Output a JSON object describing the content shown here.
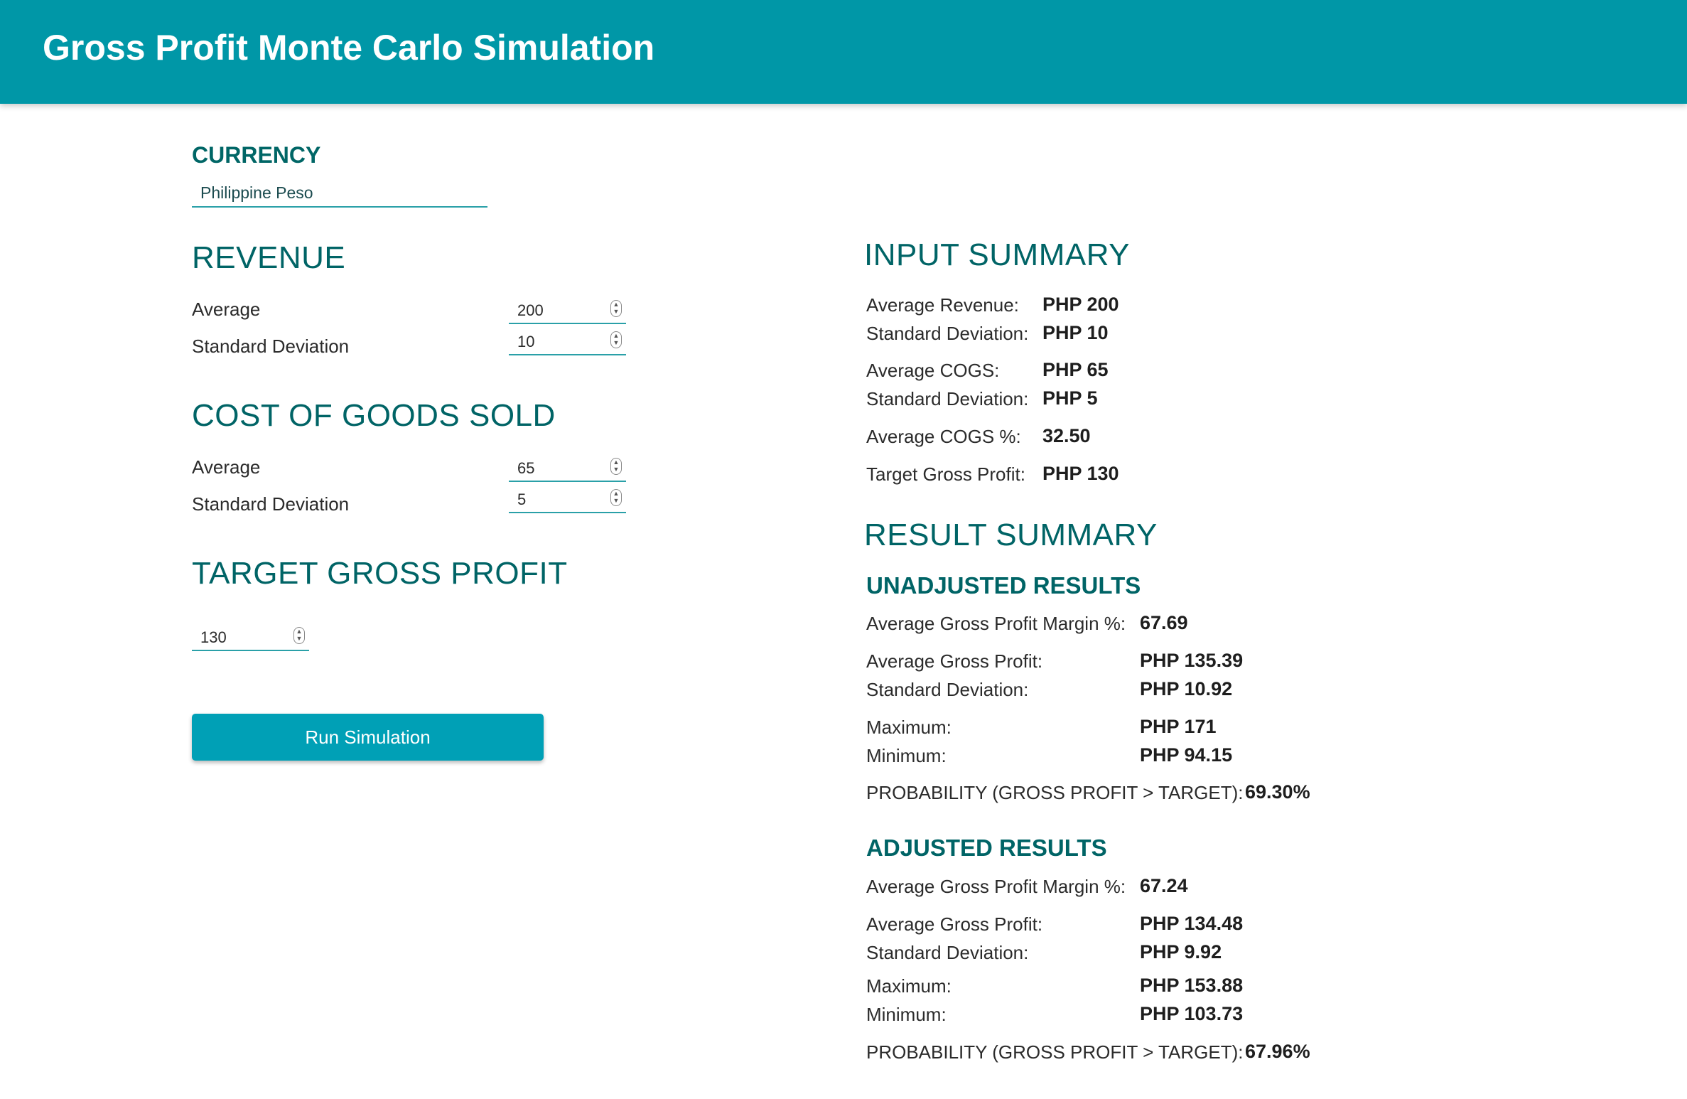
{
  "header": {
    "title": "Gross Profit Monte Carlo Simulation"
  },
  "currency": {
    "heading": "CURRENCY",
    "selected": "Philippine Peso"
  },
  "revenue": {
    "heading": "REVENUE",
    "average_label": "Average",
    "average_value": "200",
    "std_label": "Standard Deviation",
    "std_value": "10"
  },
  "cogs": {
    "heading": "COST OF GOODS SOLD",
    "average_label": "Average",
    "average_value": "65",
    "std_label": "Standard Deviation",
    "std_value": "5"
  },
  "target": {
    "heading": "TARGET GROSS PROFIT",
    "value": "130"
  },
  "run_button_label": "Run Simulation",
  "input_summary": {
    "heading": "INPUT SUMMARY",
    "rows": [
      {
        "label": "Average Revenue:",
        "value": "PHP 200"
      },
      {
        "label": "Standard Deviation:",
        "value": "PHP 10"
      },
      {
        "label": "Average COGS:",
        "value": "PHP 65"
      },
      {
        "label": "Standard Deviation:",
        "value": "PHP 5"
      },
      {
        "label": "Average COGS %:",
        "value": "32.50"
      },
      {
        "label": "Target Gross Profit:",
        "value": "PHP 130"
      }
    ]
  },
  "result_summary": {
    "heading": "RESULT SUMMARY",
    "unadjusted": {
      "heading": "UNADJUSTED RESULTS",
      "margin_label": "Average Gross Profit Margin %:",
      "margin_value": "67.69",
      "avg_label": "Average Gross Profit:",
      "avg_value": "PHP 135.39",
      "std_label": "Standard Deviation:",
      "std_value": "PHP 10.92",
      "max_label": "Maximum:",
      "max_value": "PHP 171",
      "min_label": "Minimum:",
      "min_value": "PHP 94.15",
      "prob_label": "PROBABILITY (GROSS PROFIT > TARGET):",
      "prob_value": "69.30%"
    },
    "adjusted": {
      "heading": "ADJUSTED RESULTS",
      "margin_label": "Average Gross Profit Margin %:",
      "margin_value": "67.24",
      "avg_label": "Average Gross Profit:",
      "avg_value": "PHP 134.48",
      "std_label": "Standard Deviation:",
      "std_value": "PHP 9.92",
      "max_label": "Maximum:",
      "max_value": "PHP 153.88",
      "min_label": "Minimum:",
      "min_value": "PHP 103.73",
      "prob_label": "PROBABILITY (GROSS PROFIT > TARGET):",
      "prob_value": "67.96%"
    }
  },
  "colors": {
    "header_bg": "#0097a7",
    "heading_teal": "#006466",
    "button_bg": "#00a0b6",
    "field_underline": "#2aa0a8"
  }
}
